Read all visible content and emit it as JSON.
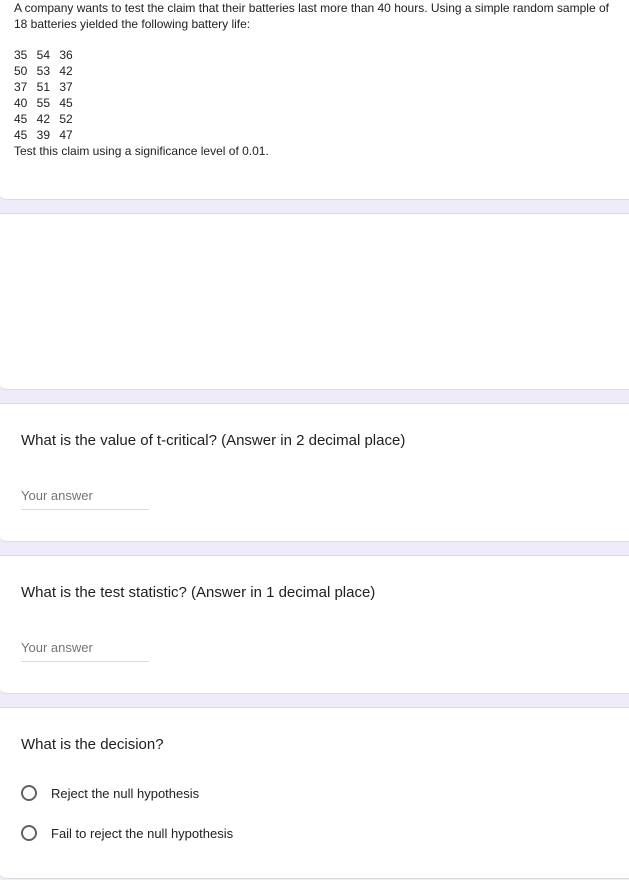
{
  "intro": {
    "text": "A company wants to test the claim that their batteries last more than 40 hours. Using a simple random sample of 18 batteries yielded the following battery life:",
    "rows": [
      "35 54 36",
      "50 53 42",
      "37 51 37",
      "40 55 45",
      "45 42 52",
      "45 39 47"
    ],
    "claim": "Test this claim using a significance level of 0.01."
  },
  "questions": [
    {
      "title": "What is the value of t-critical? (Answer in 2 decimal place)",
      "placeholder": "Your answer"
    },
    {
      "title": "What is the test statistic? (Answer in 1 decimal place)",
      "placeholder": "Your answer"
    },
    {
      "title": "What is the decision?",
      "options": [
        "Reject the null hypothesis",
        "Fail to reject the null hypothesis"
      ]
    }
  ]
}
